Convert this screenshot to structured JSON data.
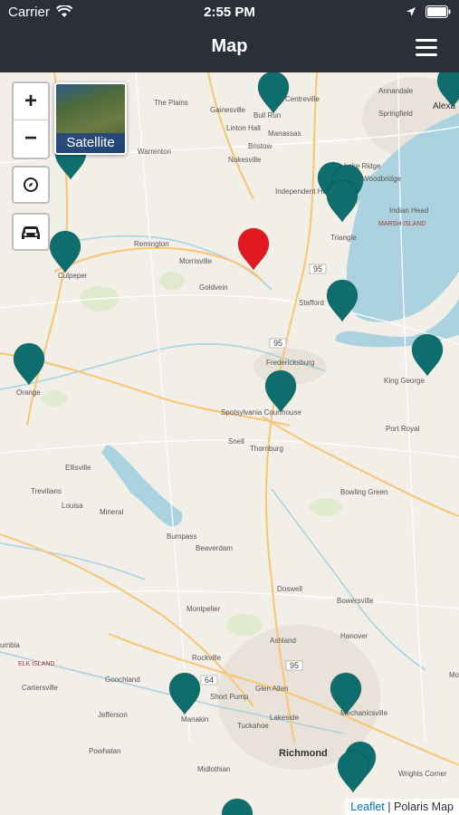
{
  "status_bar": {
    "carrier": "Carrier",
    "time": "2:55 PM"
  },
  "header": {
    "title": "Map"
  },
  "controls": {
    "zoom_in": "+",
    "zoom_out": "−",
    "satellite_label": "Satellite"
  },
  "attribution": {
    "leaflet": "Leaflet",
    "separator": "|",
    "provider": "Polaris Map"
  },
  "place_labels": [
    "The Plains",
    "Centreville",
    "Annandale",
    "Alexa",
    "Gainesville",
    "Bull Run",
    "Springfield",
    "Linton Hall",
    "Manassas",
    "Warrenton",
    "Bristow",
    "Lake Ridge",
    "Woodbridge",
    "Nokesville",
    "Independent Hill",
    "Indian Head",
    "MARSH ISLAND",
    "Triangle",
    "Remington",
    "Culpeper",
    "Morrisville",
    "Goldvein",
    "Stafford",
    "Orange",
    "Fredericksburg",
    "King George",
    "Spotsylvania Courthouse",
    "Port Royal",
    "Snell",
    "Thornburg",
    "Ellisville",
    "Trevilians",
    "Louisa",
    "Mineral",
    "Bowling Green",
    "Bumpass",
    "Beaverdam",
    "Doswell",
    "Bowersville",
    "Montpelier",
    "Ashland",
    "Hanover",
    "umbia",
    "ELK ISLAND",
    "Rockville",
    "Cartersville",
    "Goochland",
    "Short Pump",
    "Glen Allen",
    "Jefferson",
    "Manakin",
    "Tuckahoe",
    "Lakeside",
    "Mechanicsville",
    "Powhatan",
    "Richmond",
    "Midlothian",
    "Wrights Corner",
    "Mont"
  ],
  "road_labels": [
    "95",
    "95",
    "64",
    "95"
  ],
  "markers": {
    "selected_color": "#e0191f",
    "default_color": "#0e6e6e"
  }
}
